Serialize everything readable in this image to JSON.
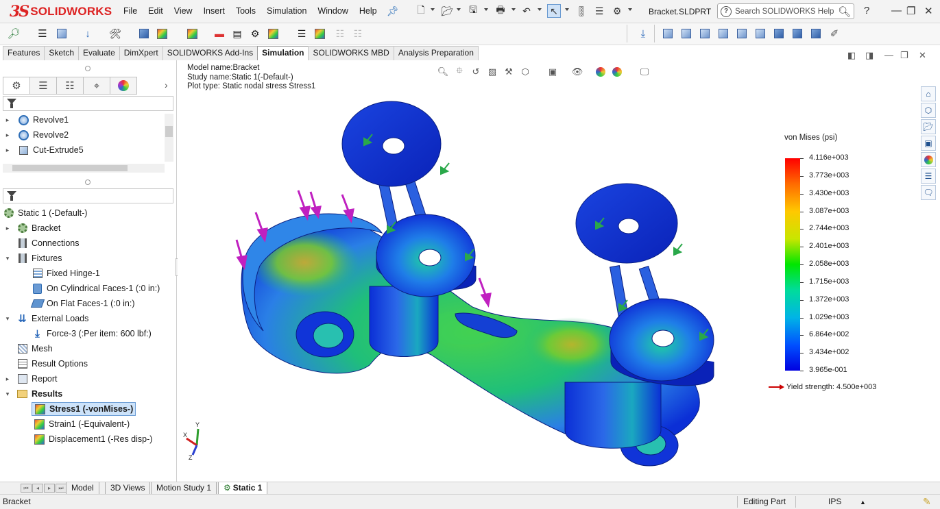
{
  "app": {
    "logo_text": "SOLIDWORKS",
    "document_title": "Bracket.SLDPRT",
    "menu": [
      "File",
      "Edit",
      "View",
      "Insert",
      "Tools",
      "Simulation",
      "Window",
      "Help"
    ],
    "search_placeholder": "Search SOLIDWORKS Help"
  },
  "command_tabs": [
    {
      "label": "Features",
      "active": false
    },
    {
      "label": "Sketch",
      "active": false
    },
    {
      "label": "Evaluate",
      "active": false
    },
    {
      "label": "DimXpert",
      "active": false
    },
    {
      "label": "SOLIDWORKS Add-Ins",
      "active": false
    },
    {
      "label": "Simulation",
      "active": true
    },
    {
      "label": "SOLIDWORKS MBD",
      "active": false
    },
    {
      "label": "Analysis Preparation",
      "active": false
    }
  ],
  "feature_tree": {
    "items": [
      "Revolve1",
      "Revolve2",
      "Cut-Extrude5"
    ]
  },
  "study_tree": {
    "root": "Static 1 (-Default-)",
    "items": [
      {
        "label": "Bracket"
      },
      {
        "label": "Connections"
      },
      {
        "label": "Fixtures"
      },
      {
        "label": "Fixed Hinge-1"
      },
      {
        "label": "On Cylindrical Faces-1 (:0 in:)"
      },
      {
        "label": "On Flat Faces-1 (:0 in:)"
      },
      {
        "label": "External Loads"
      },
      {
        "label": "Force-3 (:Per item: 600 lbf:)"
      },
      {
        "label": "Mesh"
      },
      {
        "label": "Result Options"
      },
      {
        "label": "Report"
      },
      {
        "label": "Results"
      },
      {
        "label": "Stress1 (-vonMises-)"
      },
      {
        "label": "Strain1 (-Equivalent-)"
      },
      {
        "label": "Displacement1 (-Res disp-)"
      }
    ]
  },
  "viewport": {
    "model_name": "Model name:Bracket",
    "study_name": "Study name:Static 1(-Default-)",
    "plot_type": "Plot type: Static nodal stress Stress1"
  },
  "legend": {
    "title": "von Mises (psi)",
    "values": [
      "4.116e+003",
      "3.773e+003",
      "3.430e+003",
      "3.087e+003",
      "2.744e+003",
      "2.401e+003",
      "2.058e+003",
      "1.715e+003",
      "1.372e+003",
      "1.029e+003",
      "6.864e+002",
      "3.434e+002",
      "3.965e-001"
    ],
    "yield_strength": "Yield strength: 4.500e+003",
    "colors": {
      "max": "#ff0000",
      "mid": "#00e600",
      "min": "#0000e0",
      "yield_arrow": "#cc0000"
    }
  },
  "triad": {
    "x": "X",
    "y": "Y",
    "z": "Z"
  },
  "bottom_tabs": [
    "Model",
    "3D Views",
    "Motion Study 1",
    "Static 1"
  ],
  "status": {
    "left": "Bracket",
    "mode": "Editing Part",
    "units": "IPS"
  },
  "colors": {
    "brand": "#d22222",
    "selection": "#cde3fa",
    "load_arrow": "#c020c0",
    "fixture_arrow": "#2aa84a"
  }
}
